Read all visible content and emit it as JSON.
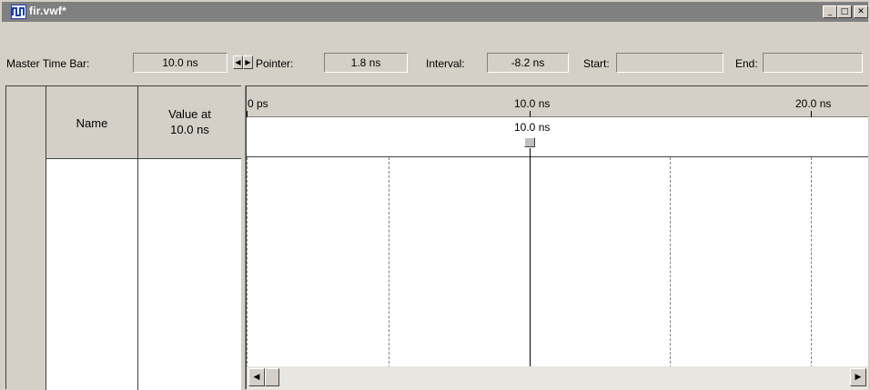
{
  "window": {
    "title": "fir.vwf*",
    "minimize_glyph": "_",
    "maximize_glyph": "□",
    "close_glyph": "✕"
  },
  "toolbar": {
    "master_time_bar_label": "Master Time Bar:",
    "master_time_bar_value": "10.0 ns",
    "arrow_left": "◀",
    "arrow_right": "▶",
    "pointer_label": "Pointer:",
    "pointer_value": "1.8 ns",
    "interval_label": "Interval:",
    "interval_value": "-8.2 ns",
    "start_label": "Start:",
    "start_value": "",
    "end_label": "End:",
    "end_value": ""
  },
  "node_table": {
    "columns": [
      "Name",
      "Value at\n10.0 ns"
    ],
    "name_header": "Name",
    "value_header_line1": "Value at",
    "value_header_line2": "10.0 ns",
    "rows": []
  },
  "waveform": {
    "ruler_ticks": [
      "0 ps",
      "10.0 ns",
      "20.0 ns"
    ],
    "cursor_label": "10.0 ns",
    "master_time_ns": 10.0
  },
  "scrollbar": {
    "left_glyph": "◀",
    "right_glyph": "▶"
  }
}
